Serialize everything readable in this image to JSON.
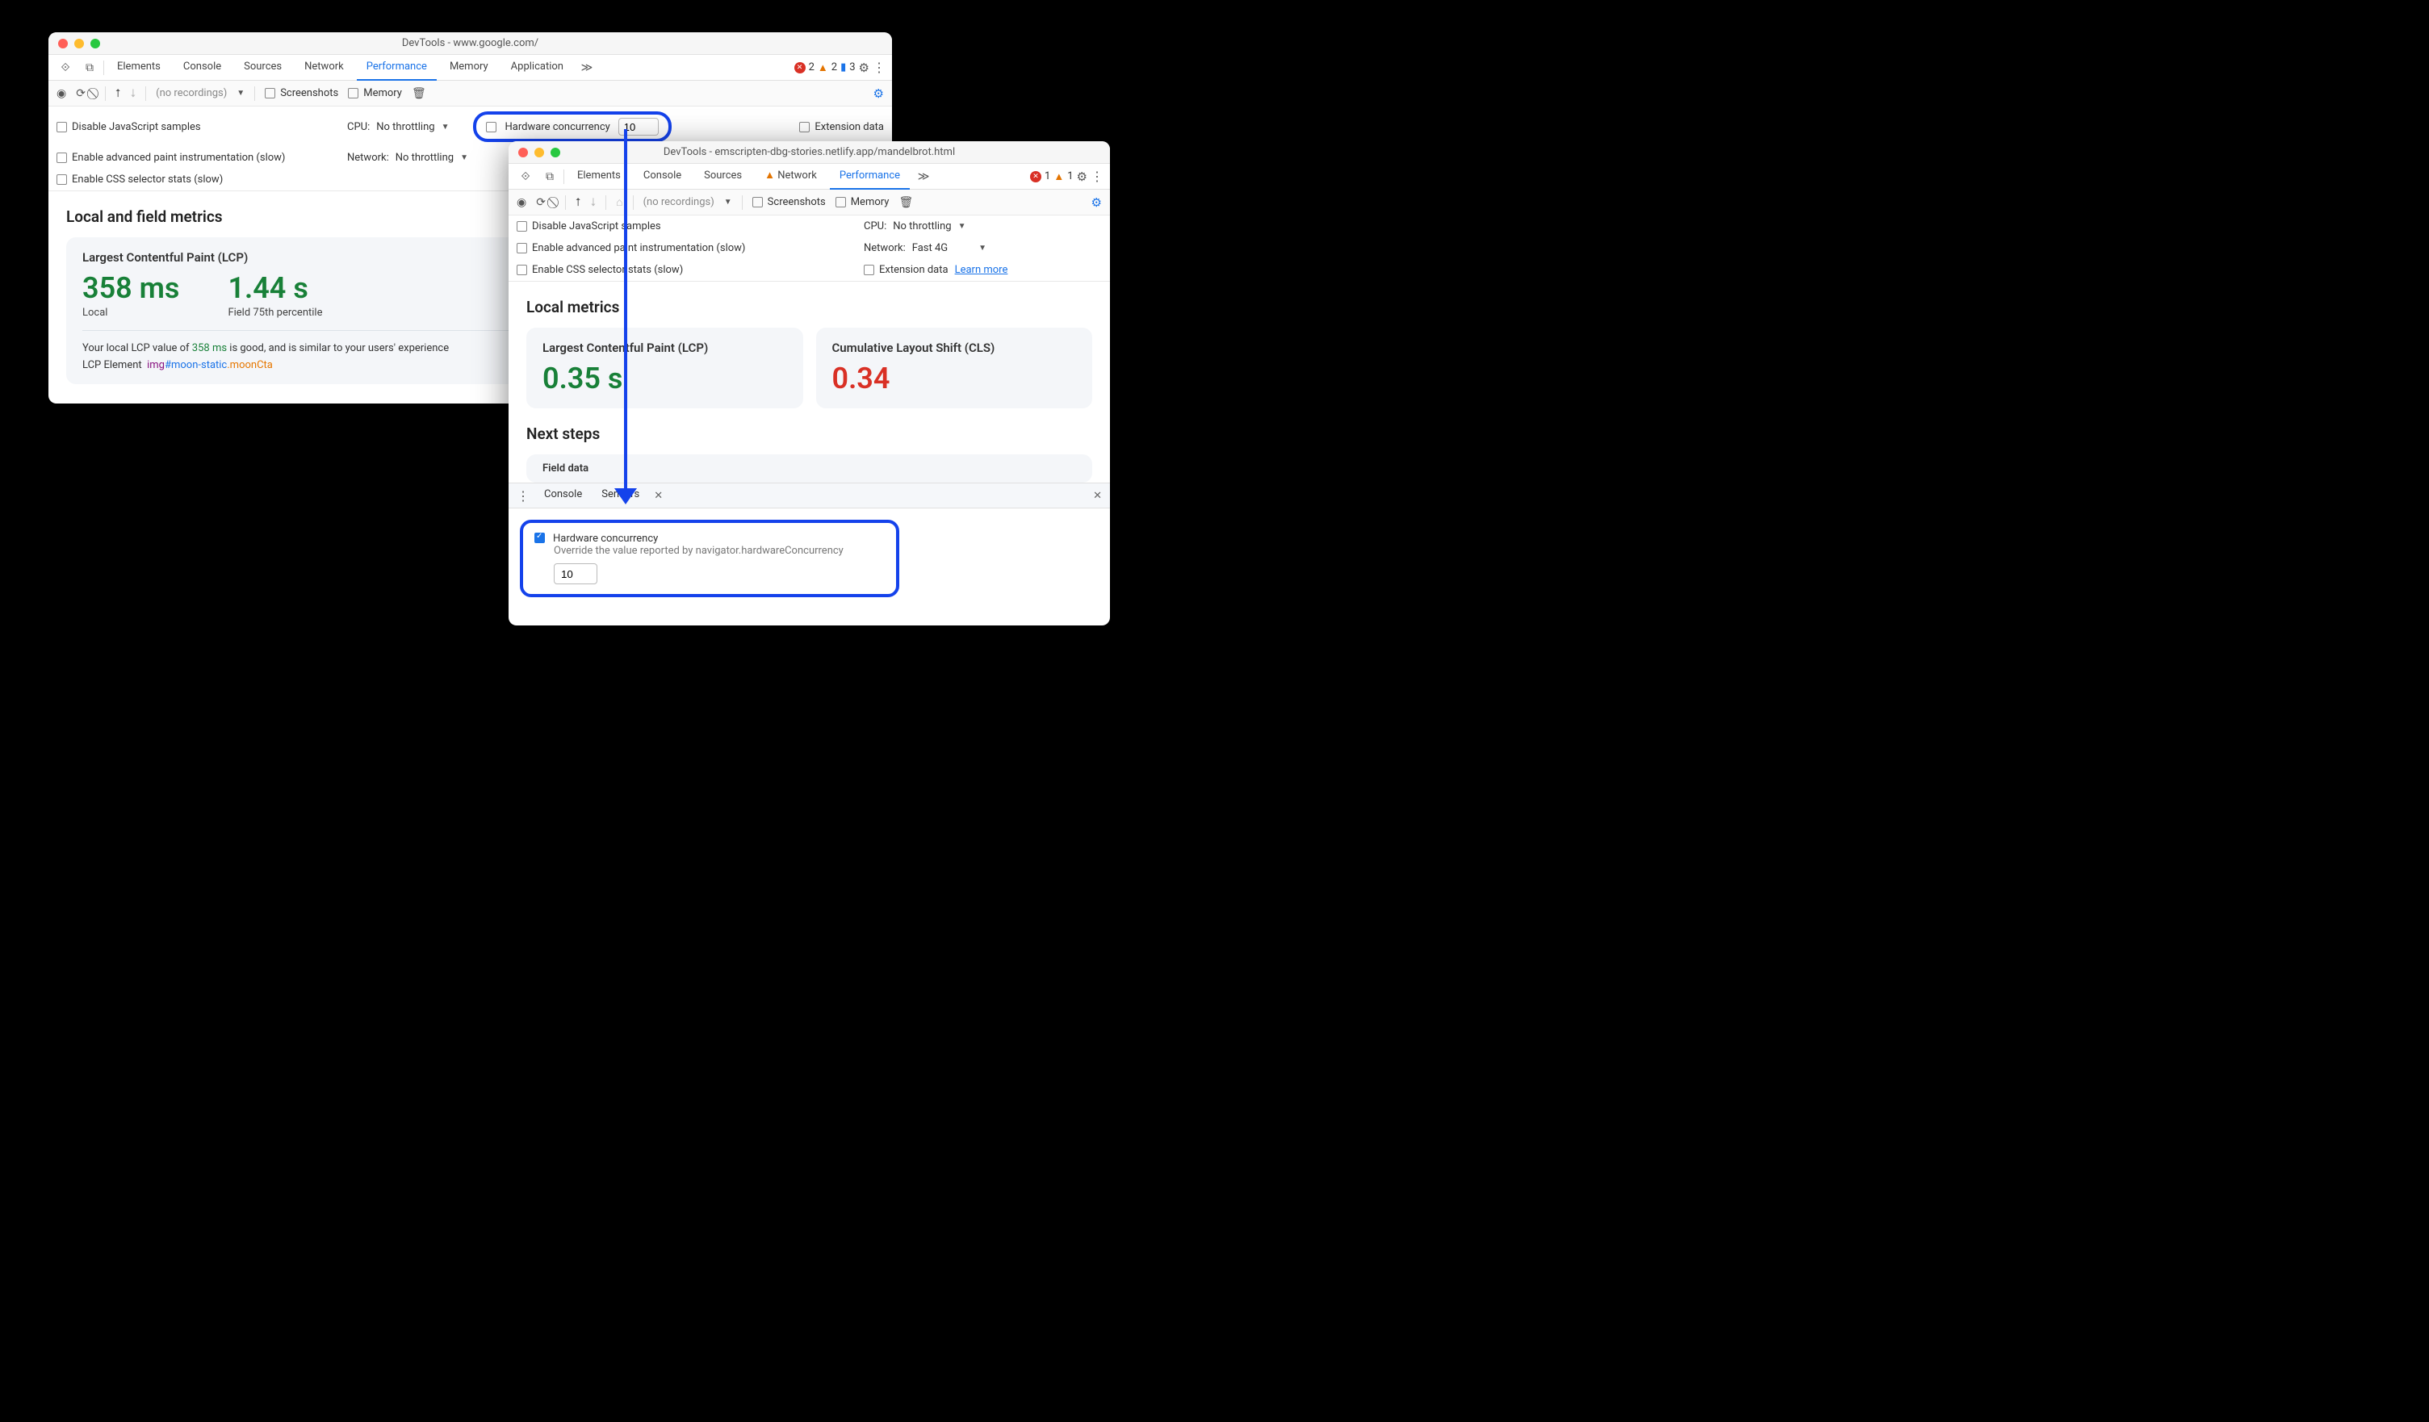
{
  "left": {
    "title": "DevTools - www.google.com/",
    "tabs": [
      "Elements",
      "Console",
      "Sources",
      "Network",
      "Performance",
      "Memory",
      "Application"
    ],
    "active_tab": "Performance",
    "errors": "2",
    "warnings": "2",
    "issues": "3",
    "toolbar": {
      "norec": "(no recordings)",
      "screenshots": "Screenshots",
      "memory": "Memory"
    },
    "opts": {
      "disable_js": "Disable JavaScript samples",
      "cpu_label": "CPU:",
      "cpu_val": "No throttling",
      "hw_label": "Hardware concurrency",
      "hw_val": "10",
      "ext_data": "Extension data",
      "adv_paint": "Enable advanced paint instrumentation (slow)",
      "net_label": "Network:",
      "net_val": "No throttling",
      "css_stats": "Enable CSS selector stats (slow)"
    },
    "metrics": {
      "title": "Local and field metrics",
      "lcp_title": "Largest Contentful Paint (LCP)",
      "local_val": "358 ms",
      "local_sub": "Local",
      "field_val": "1.44 s",
      "field_sub": "Field 75th percentile",
      "desc_pre": "Your local LCP value of ",
      "desc_val": "358 ms",
      "desc_post": " is good, and is similar to your users' experience",
      "elem_label": "LCP Element",
      "elem_tag": "img",
      "elem_id": "#moon-static",
      "elem_cls": ".moonCta"
    }
  },
  "right": {
    "title": "DevTools - emscripten-dbg-stories.netlify.app/mandelbrot.html",
    "tabs": [
      "Elements",
      "Console",
      "Sources",
      "Network",
      "Performance"
    ],
    "active_tab": "Performance",
    "net_warn": true,
    "errors": "1",
    "warnings": "1",
    "toolbar": {
      "norec": "(no recordings)",
      "screenshots": "Screenshots",
      "memory": "Memory"
    },
    "opts": {
      "disable_js": "Disable JavaScript samples",
      "cpu_label": "CPU:",
      "cpu_val": "No throttling",
      "adv_paint": "Enable advanced paint instrumentation (slow)",
      "net_label": "Network:",
      "net_val": "Fast 4G",
      "css_stats": "Enable CSS selector stats (slow)",
      "ext_data": "Extension data",
      "learn": "Learn more"
    },
    "metrics": {
      "title": "Local metrics",
      "lcp_title": "Largest Contentful Paint (LCP)",
      "lcp_val": "0.35 s",
      "cls_title": "Cumulative Layout Shift (CLS)",
      "cls_val": "0.34",
      "next_steps": "Next steps",
      "field_data": "Field data"
    },
    "drawer": {
      "console": "Console",
      "sensors": "Sensors",
      "hw_label": "Hardware concurrency",
      "hw_sub": "Override the value reported by navigator.hardwareConcurrency",
      "hw_val": "10"
    }
  }
}
